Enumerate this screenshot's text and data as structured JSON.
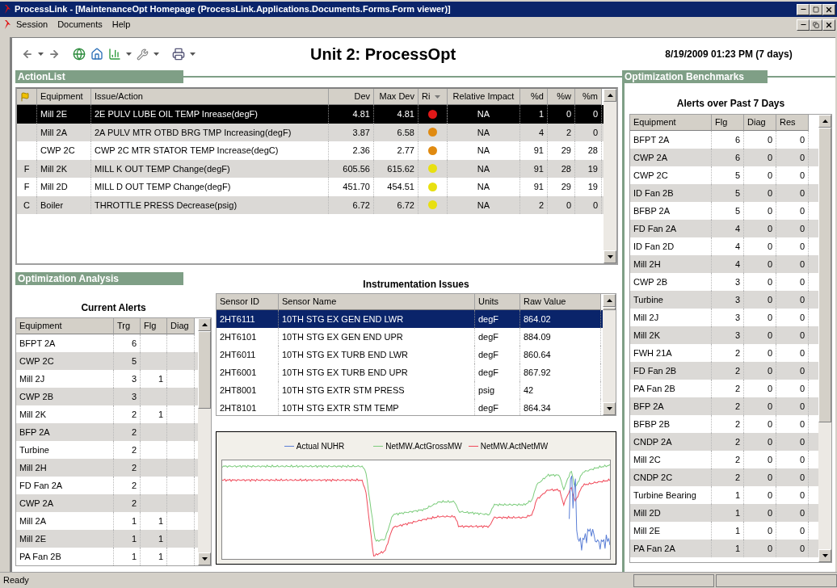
{
  "window": {
    "title": "ProcessLink - [MaintenanceOpt Homepage (ProcessLink.Applications.Documents.Forms.Form viewer)]"
  },
  "menu": [
    {
      "label": "Session"
    },
    {
      "label": "Documents"
    },
    {
      "label": "Help"
    }
  ],
  "page": {
    "heading": "Unit 2: ProcessOpt",
    "timestamp": "8/19/2009 01:23 PM (7 days)"
  },
  "action_list": {
    "title": "ActionList",
    "columns": [
      "Equipment",
      "Issue/Action",
      "Dev",
      "Max Dev",
      "Ri",
      "Relative Impact",
      "%d",
      "%w",
      "%m"
    ],
    "rows": [
      {
        "equipment": "Mill 2E",
        "issue": "2E PULV LUBE OIL TEMP Inrease(degF)",
        "dev": "4.81",
        "max_dev": "4.81",
        "color": "#e01818",
        "impact": "NA",
        "pct_d": "1",
        "pct_w": "0",
        "pct_m": "0",
        "selected": true
      },
      {
        "equipment": "Mill 2A",
        "issue": "2A PULV MTR OTBD BRG TMP Increasing(degF)",
        "dev": "3.87",
        "max_dev": "6.58",
        "color": "#e08a10",
        "impact": "NA",
        "pct_d": "4",
        "pct_w": "2",
        "pct_m": "0",
        "selected": false
      },
      {
        "equipment": "CWP 2C",
        "issue": "CWP 2C MTR STATOR TEMP Increase(degC)",
        "dev": "2.36",
        "max_dev": "2.77",
        "color": "#e08a10",
        "impact": "NA",
        "pct_d": "91",
        "pct_w": "29",
        "pct_m": "28",
        "selected": false
      },
      {
        "flag": "F",
        "equipment": "Mill 2K",
        "issue": "MILL K OUT TEMP Change(degF)",
        "dev": "605.56",
        "max_dev": "615.62",
        "color": "#e8e010",
        "impact": "NA",
        "pct_d": "91",
        "pct_w": "28",
        "pct_m": "19",
        "selected": false
      },
      {
        "flag": "F",
        "equipment": "Mill 2D",
        "issue": "MILL D OUT TEMP Change(degF)",
        "dev": "451.70",
        "max_dev": "454.51",
        "color": "#e8e010",
        "impact": "NA",
        "pct_d": "91",
        "pct_w": "29",
        "pct_m": "19",
        "selected": false
      },
      {
        "flag": "C",
        "equipment": "Boiler",
        "issue": "THROTTLE PRESS Decrease(psig)",
        "dev": "6.72",
        "max_dev": "6.72",
        "color": "#e8e010",
        "impact": "NA",
        "pct_d": "2",
        "pct_w": "0",
        "pct_m": "0",
        "selected": false
      }
    ]
  },
  "optimization_analysis": {
    "title": "Optimization Analysis",
    "current_alerts": {
      "title": "Current Alerts",
      "columns": [
        "Equipment",
        "Trg",
        "Flg",
        "Diag"
      ],
      "rows": [
        {
          "equipment": "BFPT 2A",
          "trg": "6"
        },
        {
          "equipment": "CWP 2C",
          "trg": "5"
        },
        {
          "equipment": "Mill 2J",
          "trg": "3",
          "flg": "1"
        },
        {
          "equipment": "CWP 2B",
          "trg": "3"
        },
        {
          "equipment": "Mill 2K",
          "trg": "2",
          "flg": "1"
        },
        {
          "equipment": "BFP 2A",
          "trg": "2"
        },
        {
          "equipment": "Turbine",
          "trg": "2"
        },
        {
          "equipment": "Mill 2H",
          "trg": "2"
        },
        {
          "equipment": "FD Fan 2A",
          "trg": "2"
        },
        {
          "equipment": "CWP 2A",
          "trg": "2"
        },
        {
          "equipment": "Mill 2A",
          "trg": "1",
          "flg": "1"
        },
        {
          "equipment": "Mill 2E",
          "trg": "1",
          "flg": "1"
        },
        {
          "equipment": "PA Fan 2B",
          "trg": "1",
          "flg": "1"
        }
      ]
    },
    "instrumentation_issues": {
      "title": "Instrumentation Issues",
      "columns": [
        "Sensor ID",
        "Sensor Name",
        "Units",
        "Raw Value"
      ],
      "rows": [
        {
          "sensor_id": "2HT6111",
          "sensor_name": "10TH STG EX GEN END LWR",
          "units": "degF",
          "raw_value": "864.02",
          "selected": true
        },
        {
          "sensor_id": "2HT6101",
          "sensor_name": "10TH STG EX GEN END UPR",
          "units": "degF",
          "raw_value": "884.09",
          "selected": false
        },
        {
          "sensor_id": "2HT6011",
          "sensor_name": "10TH STG EX TURB END LWR",
          "units": "degF",
          "raw_value": "860.64",
          "selected": false
        },
        {
          "sensor_id": "2HT6001",
          "sensor_name": "10TH STG EX TURB END UPR",
          "units": "degF",
          "raw_value": "867.92",
          "selected": false
        },
        {
          "sensor_id": "2HT8001",
          "sensor_name": "10TH STG EXTR STM PRESS",
          "units": "psig",
          "raw_value": "42",
          "selected": false
        },
        {
          "sensor_id": "2HT8101",
          "sensor_name": "10TH STG EXTR STM TEMP",
          "units": "degF",
          "raw_value": "864.34",
          "selected": false
        }
      ]
    },
    "trend_chart": {
      "legend": [
        {
          "label": "Actual NUHR",
          "color": "#5b7fd6"
        },
        {
          "label": "NetMW.ActGrossMW",
          "color": "#7ccc7c"
        },
        {
          "label": "NetMW.ActNetMW",
          "color": "#f04a5a"
        }
      ]
    }
  },
  "benchmarks": {
    "title": "Optimization Benchmarks",
    "alerts": {
      "title": "Alerts over Past 7 Days",
      "columns": [
        "Equipment",
        "Flg",
        "Diag",
        "Res"
      ],
      "rows": [
        {
          "equipment": "BFPT 2A",
          "flg": "6",
          "diag": "0",
          "res": "0"
        },
        {
          "equipment": "CWP 2A",
          "flg": "6",
          "diag": "0",
          "res": "0"
        },
        {
          "equipment": "CWP 2C",
          "flg": "5",
          "diag": "0",
          "res": "0"
        },
        {
          "equipment": "ID Fan 2B",
          "flg": "5",
          "diag": "0",
          "res": "0"
        },
        {
          "equipment": "BFBP 2A",
          "flg": "5",
          "diag": "0",
          "res": "0"
        },
        {
          "equipment": "FD Fan 2A",
          "flg": "4",
          "diag": "0",
          "res": "0"
        },
        {
          "equipment": "ID Fan 2D",
          "flg": "4",
          "diag": "0",
          "res": "0"
        },
        {
          "equipment": "Mill 2H",
          "flg": "4",
          "diag": "0",
          "res": "0"
        },
        {
          "equipment": "CWP 2B",
          "flg": "3",
          "diag": "0",
          "res": "0"
        },
        {
          "equipment": "Turbine",
          "flg": "3",
          "diag": "0",
          "res": "0"
        },
        {
          "equipment": "Mill 2J",
          "flg": "3",
          "diag": "0",
          "res": "0"
        },
        {
          "equipment": "Mill 2K",
          "flg": "3",
          "diag": "0",
          "res": "0"
        },
        {
          "equipment": "FWH 21A",
          "flg": "2",
          "diag": "0",
          "res": "0"
        },
        {
          "equipment": "FD Fan 2B",
          "flg": "2",
          "diag": "0",
          "res": "0"
        },
        {
          "equipment": "PA Fan 2B",
          "flg": "2",
          "diag": "0",
          "res": "0"
        },
        {
          "equipment": "BFP 2A",
          "flg": "2",
          "diag": "0",
          "res": "0"
        },
        {
          "equipment": "BFBP 2B",
          "flg": "2",
          "diag": "0",
          "res": "0"
        },
        {
          "equipment": "CNDP 2A",
          "flg": "2",
          "diag": "0",
          "res": "0"
        },
        {
          "equipment": "Mill 2C",
          "flg": "2",
          "diag": "0",
          "res": "0"
        },
        {
          "equipment": "CNDP 2C",
          "flg": "2",
          "diag": "0",
          "res": "0"
        },
        {
          "equipment": "Turbine Bearing",
          "flg": "1",
          "diag": "0",
          "res": "0"
        },
        {
          "equipment": "Mill 2D",
          "flg": "1",
          "diag": "0",
          "res": "0"
        },
        {
          "equipment": "Mill 2E",
          "flg": "1",
          "diag": "0",
          "res": "0"
        },
        {
          "equipment": "PA Fan 2A",
          "flg": "1",
          "diag": "0",
          "res": "0"
        }
      ]
    }
  },
  "status_bar": {
    "text": "Ready"
  }
}
